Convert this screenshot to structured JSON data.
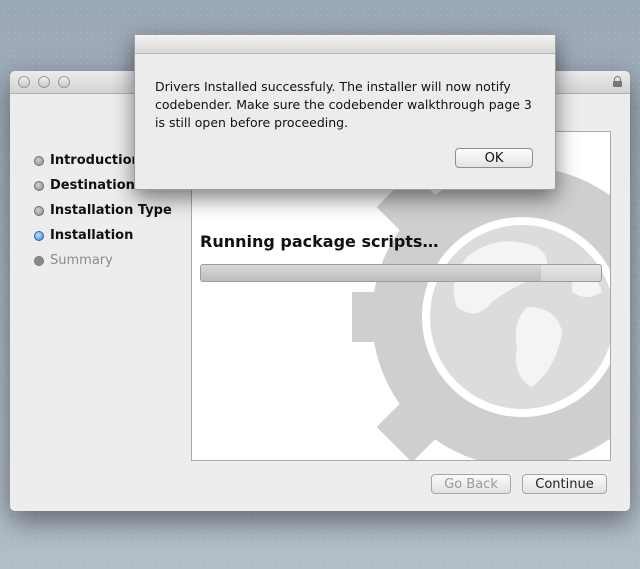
{
  "sidebar": {
    "steps": [
      {
        "label": "Introduction",
        "state": "done"
      },
      {
        "label": "Destination Select",
        "state": "done"
      },
      {
        "label": "Installation Type",
        "state": "done"
      },
      {
        "label": "Installation",
        "state": "active"
      },
      {
        "label": "Summary",
        "state": "future"
      }
    ]
  },
  "main": {
    "status": "Running package scripts…",
    "progress_fraction": 0.85
  },
  "buttons": {
    "go_back": "Go Back",
    "continue": "Continue"
  },
  "alert": {
    "message": "Drivers Installed successfuly. The installer will now notify codebender. Make sure the codebender walkthrough page 3 is still open before proceeding.",
    "ok_label": "OK"
  },
  "icons": {
    "background_art": "globe-gear-icon",
    "lock": "lock-icon"
  }
}
